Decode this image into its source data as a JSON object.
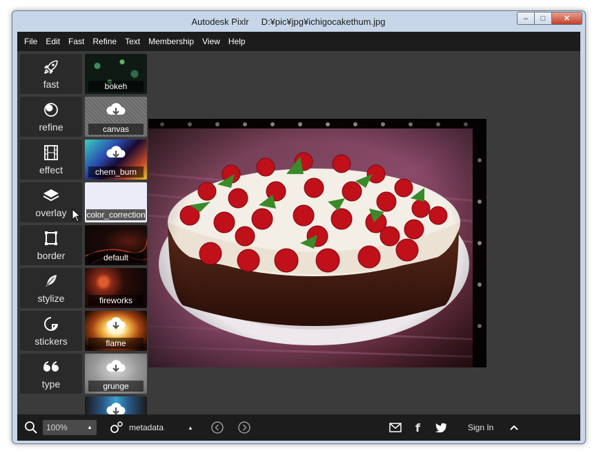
{
  "window": {
    "app_name": "Autodesk Pixlr",
    "file_path": "D:¥pic¥jpg¥ichigocakethum.jpg",
    "controls": {
      "minimize": "–",
      "maximize": "□",
      "close": "✕"
    }
  },
  "menu": [
    "File",
    "Edit",
    "Fast",
    "Refine",
    "Text",
    "Membership",
    "View",
    "Help"
  ],
  "tools": [
    {
      "label": "fast",
      "icon": "rocket-icon"
    },
    {
      "label": "refine",
      "icon": "refine-circles-icon"
    },
    {
      "label": "effect",
      "icon": "film-icon"
    },
    {
      "label": "overlay",
      "icon": "layers-icon"
    },
    {
      "label": "border",
      "icon": "border-frame-icon"
    },
    {
      "label": "stylize",
      "icon": "feather-icon"
    },
    {
      "label": "stickers",
      "icon": "sticker-icon"
    },
    {
      "label": "type",
      "icon": "quote-icon"
    }
  ],
  "overlays": [
    {
      "label": "bokeh",
      "download": false
    },
    {
      "label": "canvas",
      "download": true
    },
    {
      "label": "chem_burn",
      "download": true
    },
    {
      "label": "color_correction",
      "download": false
    },
    {
      "label": "default",
      "download": false
    },
    {
      "label": "fireworks",
      "download": false
    },
    {
      "label": "flame",
      "download": true
    },
    {
      "label": "grunge",
      "download": true
    },
    {
      "label": "",
      "download": true
    }
  ],
  "bottom": {
    "zoom_value": "100%",
    "metadata_label": "metadata",
    "signin_label": "Sign In"
  },
  "colors": {
    "menubar": "#1c1c1c",
    "workspace": "#3b3b3b",
    "tool_button": "#2a2a2a"
  }
}
